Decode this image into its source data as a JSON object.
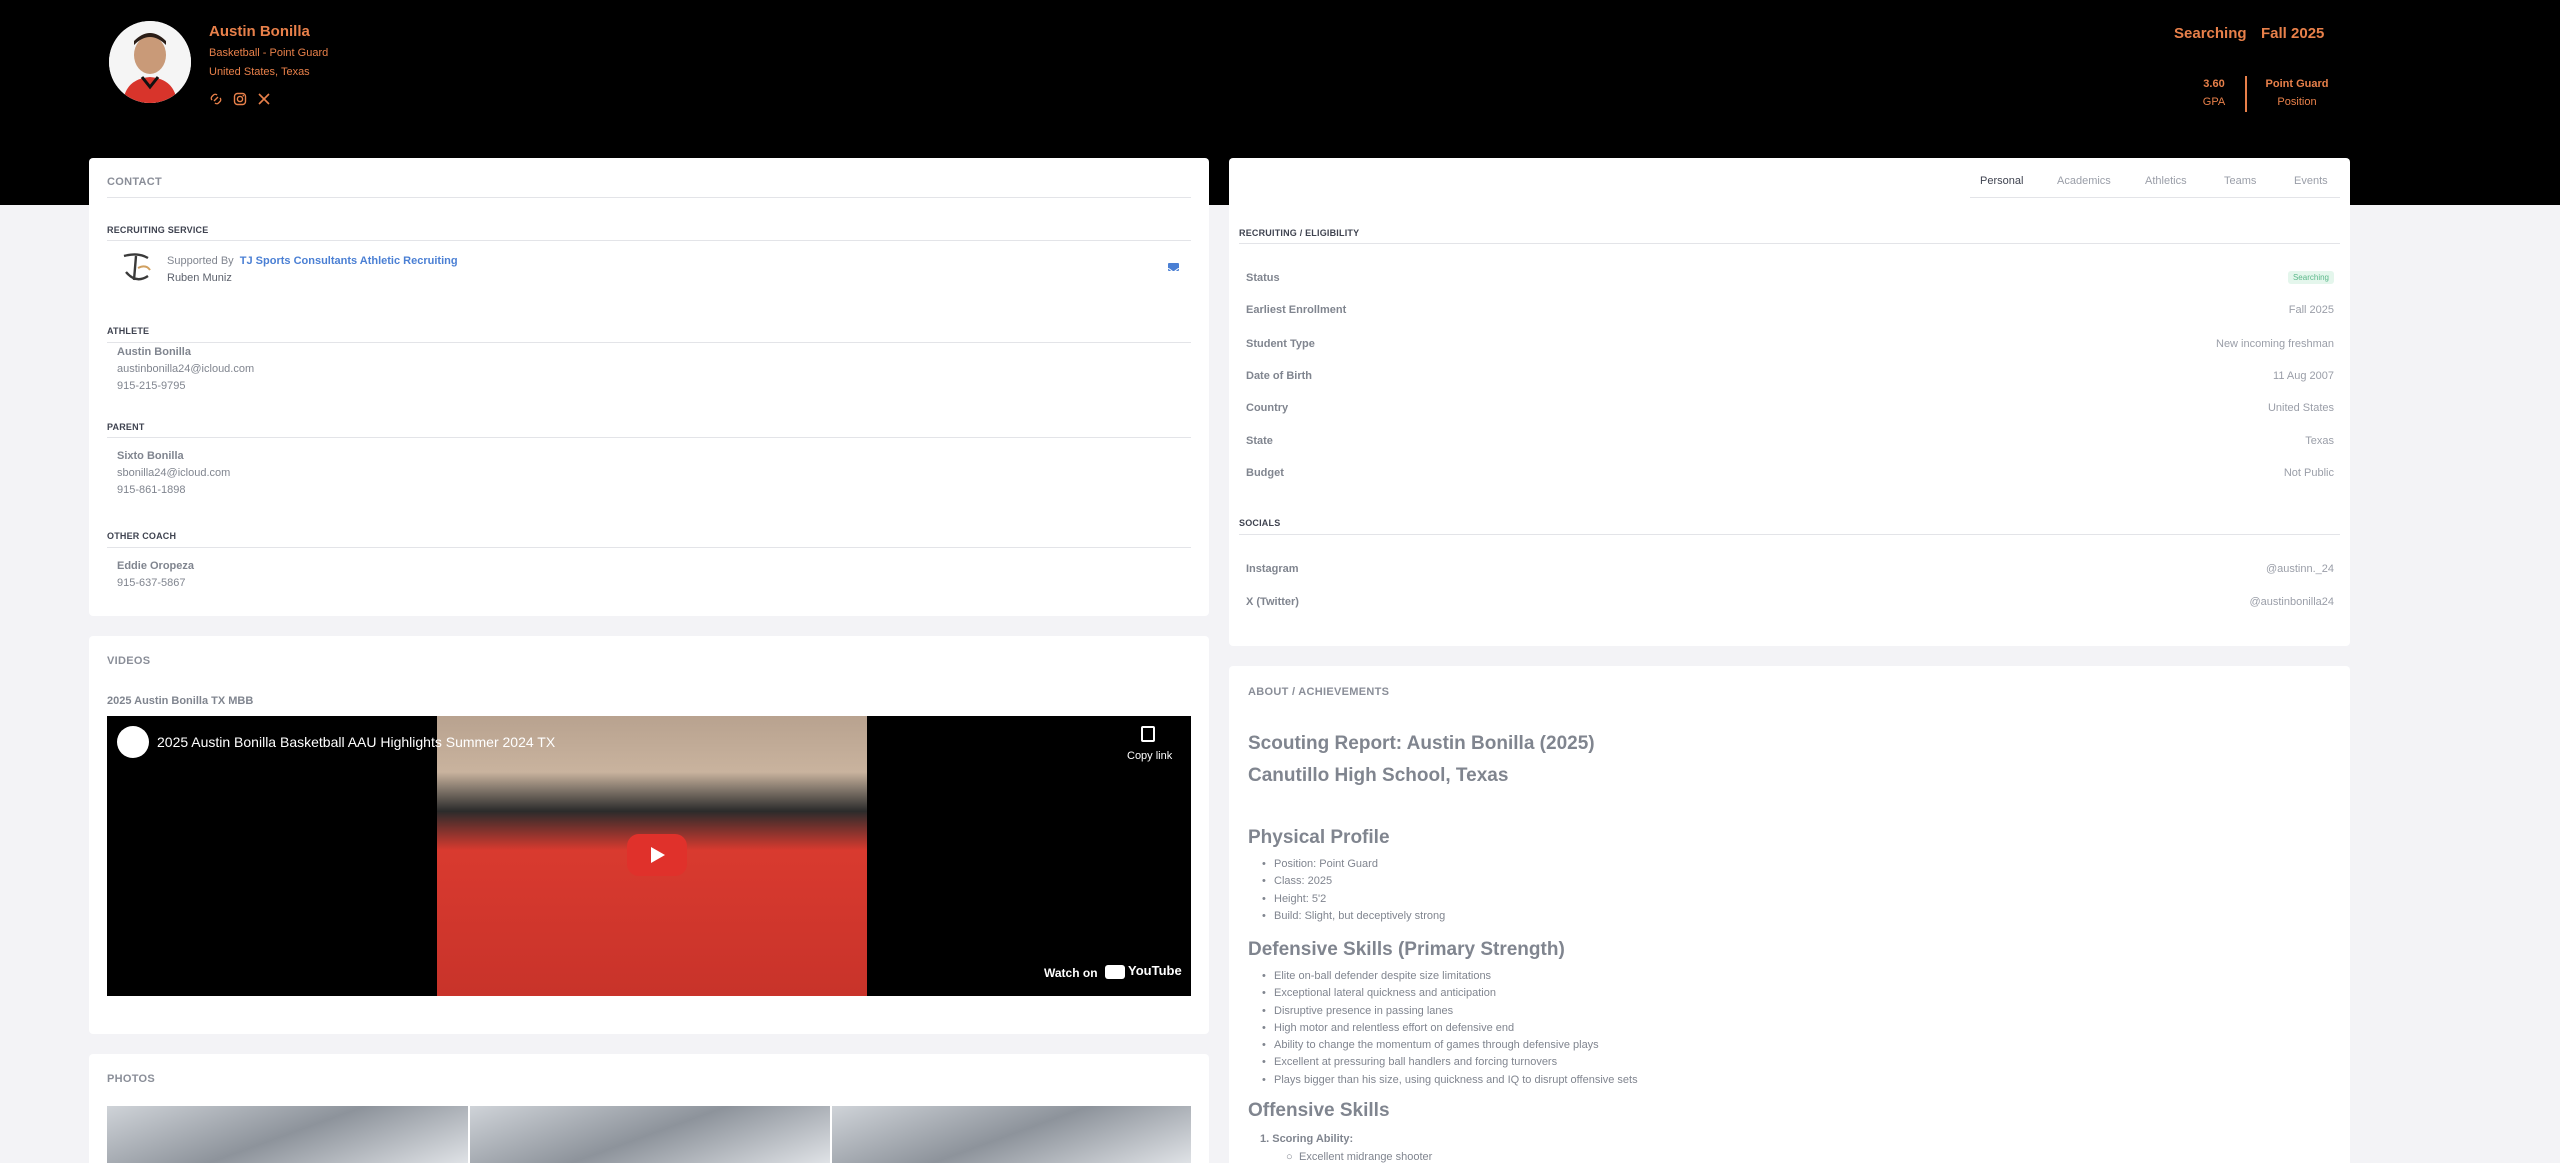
{
  "profile": {
    "name": "Austin Bonilla",
    "sport": "Basketball  -  Point Guard",
    "location": "United States, Texas",
    "status": "Searching",
    "term": "Fall 2025",
    "gpa_value": "3.60",
    "gpa_label": "GPA",
    "position_value": "Point Guard",
    "position_label": "Position",
    "social_icons": [
      "link-icon",
      "instagram-icon",
      "x-icon"
    ]
  },
  "contact": {
    "title": "CONTACT",
    "recruiting_label": "RECRUITING SERVICE",
    "supported_by": "Supported By",
    "service_name": "TJ Sports Consultants Athletic Recruiting",
    "service_contact": "Ruben Muniz",
    "athlete_label": "ATHLETE",
    "athlete_name": "Austin Bonilla",
    "athlete_email": "austinbonilla24@icloud.com",
    "athlete_phone": "915-215-9795",
    "parent_label": "PARENT",
    "parent_name": "Sixto Bonilla",
    "parent_email": "sbonilla24@icloud.com",
    "parent_phone": "915-861-1898",
    "coach_label": "OTHER COACH",
    "coach_name": "Eddie Oropeza",
    "coach_phone": "915-637-5867"
  },
  "videos": {
    "title": "VIDEOS",
    "video_heading": "2025 Austin Bonilla TX MBB",
    "embed_title": "2025 Austin Bonilla Basketball AAU Highlights Summer 2024 TX",
    "copy_link": "Copy link",
    "watch_on": "Watch on",
    "youtube": "YouTube"
  },
  "photos": {
    "title": "PHOTOS"
  },
  "tabs": [
    "Personal",
    "Academics",
    "Athletics",
    "Teams",
    "Events"
  ],
  "personal": {
    "recruiting_heading": "RECRUITING / ELIGIBILITY",
    "rows": [
      {
        "label": "Status",
        "value": "Searching"
      },
      {
        "label": "Earliest Enrollment",
        "value": "Fall 2025"
      },
      {
        "label": "Student Type",
        "value": "New incoming freshman"
      },
      {
        "label": "Date of Birth",
        "value": "11 Aug 2007"
      },
      {
        "label": "Country",
        "value": "United States"
      },
      {
        "label": "State",
        "value": "Texas"
      },
      {
        "label": "Budget",
        "value": "Not Public"
      }
    ],
    "socials_heading": "SOCIALS",
    "socials": [
      {
        "label": "Instagram",
        "value": "@austinn._24"
      },
      {
        "label": "X (Twitter)",
        "value": "@austinbonilla24"
      }
    ]
  },
  "about": {
    "title": "ABOUT / ACHIEVEMENTS",
    "report_title": "Scouting Report: Austin Bonilla (2025)",
    "school": "Canutillo High School, Texas",
    "physical_heading": "Physical Profile",
    "physical": [
      "Position: Point Guard",
      "Class: 2025",
      "Height: 5'2",
      "Build: Slight, but deceptively strong"
    ],
    "defensive_heading": "Defensive Skills (Primary Strength)",
    "defensive": [
      "Elite on-ball defender despite size limitations",
      "Exceptional lateral quickness and anticipation",
      "Disruptive presence in passing lanes",
      "High motor and relentless effort on defensive end",
      "Ability to change the momentum of games through defensive plays",
      "Excellent at pressuring ball handlers and forcing turnovers",
      "Plays bigger than his size, using quickness and IQ to disrupt offensive sets"
    ],
    "offensive_heading": "Offensive Skills",
    "scoring_label": "1. Scoring Ability:",
    "scoring_sub": "Excellent midrange shooter"
  }
}
